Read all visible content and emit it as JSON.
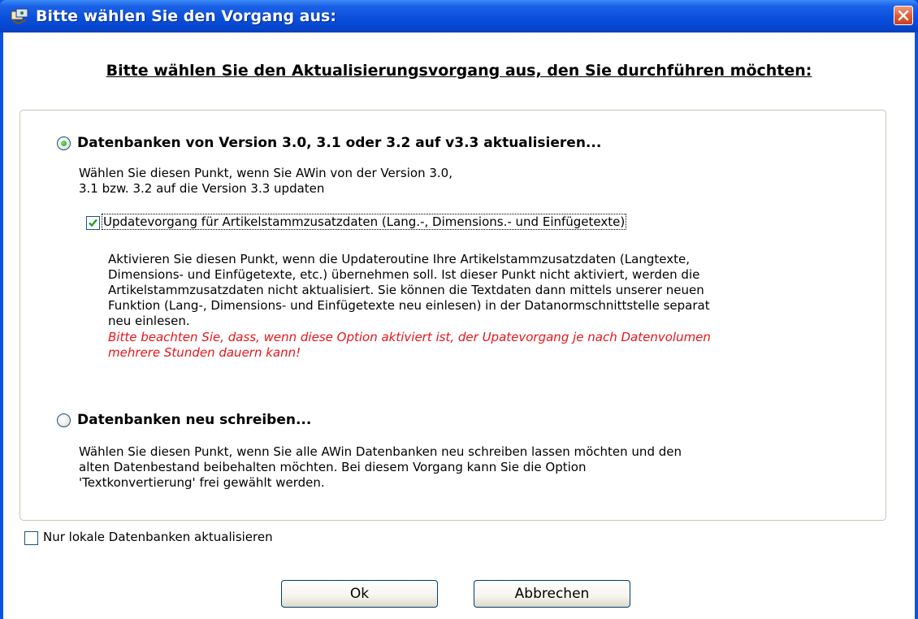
{
  "window": {
    "title": "Bitte wählen Sie den Vorgang aus:"
  },
  "heading": "Bitte wählen Sie den Aktualisierungsvorgang aus, den Sie durchführen möchten:",
  "option1": {
    "label": "Datenbanken von Version 3.0, 3.1 oder 3.2 auf v3.3 aktualisieren...",
    "selected": true,
    "description": "Wählen Sie diesen Punkt, wenn Sie AWin von der Version 3.0,\n3.1 bzw. 3.2 auf die Version 3.3 updaten",
    "sub_checkbox": {
      "label": "Updatevorgang für Artikelstammzusatzdaten (Lang.-, Dimensions.- und Einfügetexte)",
      "checked": true
    },
    "sub_description": "Aktivieren Sie diesen Punkt, wenn die Updateroutine Ihre Artikelstammzusatzdaten (Langtexte,\nDimensions- und Einfügetexte, etc.) übernehmen soll. Ist dieser Punkt nicht aktiviert, werden die\nArtikelstammzusatzdaten nicht aktualisiert. Sie können die Textdaten dann mittels unserer neuen\nFunktion (Lang-, Dimensions- und Einfügetexte neu einlesen) in der Datanormschnittstelle separat\nneu einlesen.",
    "warning": "Bitte beachten Sie, dass, wenn diese Option aktiviert ist, der Upatevorgang je nach Datenvolumen\nmehrere Stunden dauern kann!"
  },
  "option2": {
    "label": "Datenbanken neu schreiben...",
    "selected": false,
    "description": "Wählen Sie diesen Punkt, wenn Sie alle AWin Datenbanken neu schreiben lassen möchten und den\nalten Datenbestand beibehalten möchten. Bei diesem Vorgang kann Sie die Option\n'Textkonvertierung' frei gewählt werden."
  },
  "local_checkbox": {
    "label": "Nur lokale Datenbanken aktualisieren",
    "checked": false
  },
  "buttons": {
    "ok": "Ok",
    "cancel": "Abbrechen"
  },
  "colors": {
    "title_bar": "#0a4fdc",
    "warning": "#e8151b",
    "close_button": "#e05a32"
  }
}
